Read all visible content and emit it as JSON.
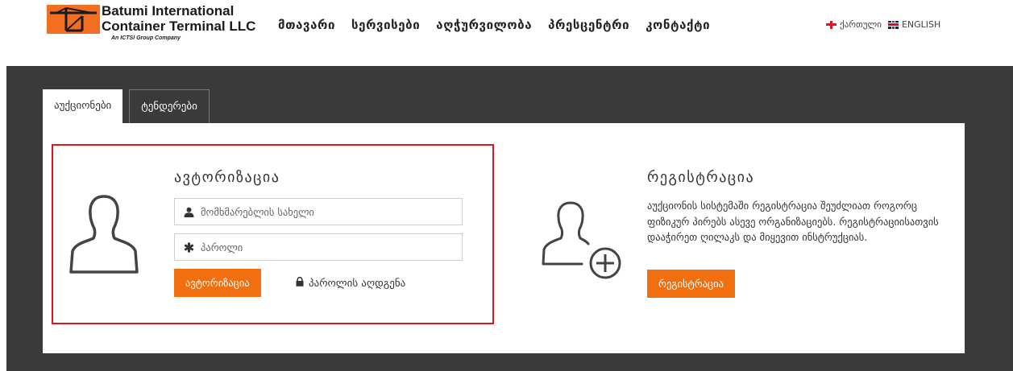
{
  "logo": {
    "line1": "Batumi International",
    "line2": "Container Terminal LLC",
    "line3": "An ICTSI Group Company"
  },
  "nav": [
    {
      "label": "მთავარი"
    },
    {
      "label": "სერვისები"
    },
    {
      "label": "აღჭურვილობა"
    },
    {
      "label": "პრესცენტრი"
    },
    {
      "label": "კონტაქტი"
    }
  ],
  "lang": {
    "georgian": "ქართული",
    "english": "ENGLISH"
  },
  "tabs": [
    {
      "label": "აუქციონები",
      "active": true
    },
    {
      "label": "ტენდერები",
      "active": false
    }
  ],
  "auth": {
    "title": "ავტორიზაცია",
    "username_placeholder": "მომხმარებლის სახელი",
    "password_placeholder": "პაროლი",
    "submit_label": "ავტორიზაცია",
    "reset_label": "პაროლის აღდგენა"
  },
  "register": {
    "title": "რეგისტრაცია",
    "description": "აუქციონის სისტემაში რეგისტრაცია შეუძლიათ როგორც ფიზიკურ პირებს ასევე ორგანიზაციებს. რეგისტრაციისათვის დააჭირეთ ღილაკს და მიყევით ინსტრუქციას.",
    "button_label": "რეგისტრაცია"
  },
  "colors": {
    "accent": "#f26f0f",
    "band": "#3a3a3a",
    "highlight_border": "#e0141e"
  }
}
